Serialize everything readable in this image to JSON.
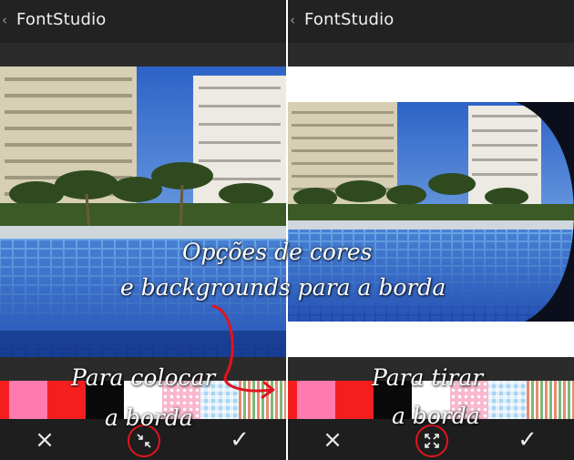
{
  "left": {
    "app_title": "FontStudio",
    "back_glyph": "‹",
    "caption_line1": "Para colocar",
    "caption_line2": "a borda",
    "tools": {
      "close": "×",
      "center_icon": "compress-icon",
      "confirm": "✓"
    }
  },
  "right": {
    "app_title": "FontStudio",
    "back_glyph": "‹",
    "caption_line1": "Para tirar",
    "caption_line2": "a borda",
    "tools": {
      "close": "×",
      "center_icon": "expand-icon",
      "confirm": "✓"
    }
  },
  "annotation": {
    "line1": "Opções de cores",
    "line2": "e backgrounds para a borda"
  },
  "swatch_colors": {
    "pink": "#ff7bad",
    "red": "#f41e1e",
    "black": "#0a0a0a",
    "white": "#ffffff",
    "pink_dots": "#f8b7cb",
    "blue_check": "#a8d4f2",
    "stripes": "#e88a70"
  },
  "accent": "#e0141e"
}
